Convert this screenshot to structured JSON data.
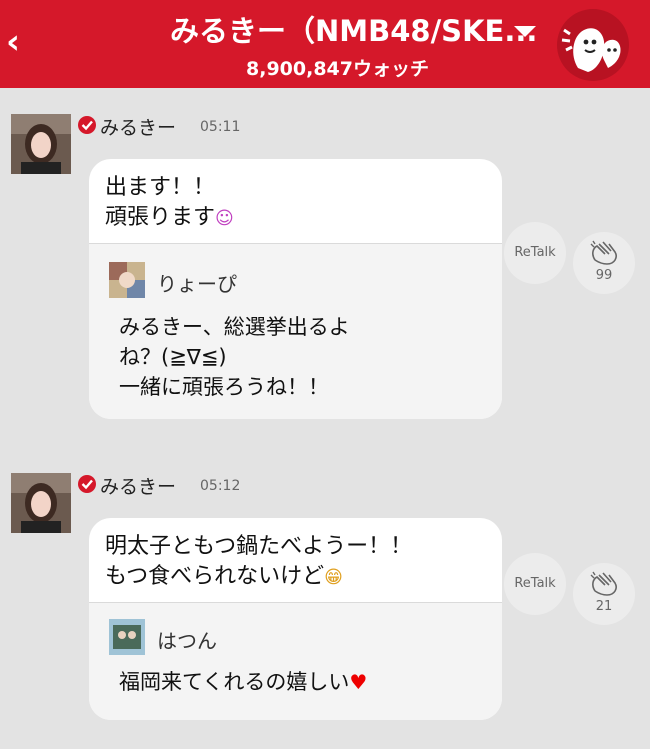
{
  "header": {
    "title": "みるきー（NMB48/SKE...",
    "watch_count": "8,900,847ウォッチ",
    "back_icon": "chevron-left-icon",
    "menu_icon": "caret-down-icon",
    "mascot_icon": "ghost-mascot-icon",
    "bg_color": "#d5182a"
  },
  "posts": [
    {
      "author": "みるきー",
      "time": "05:11",
      "message": "出ます！！\n頑張ります",
      "emoji": "☺",
      "quote": {
        "author": "りょーぴ",
        "text": "みるきー、総選挙出るよ\nね？(≧∇≦)\n一緒に頑張ろうね！！"
      },
      "retalk_label": "ReTalk",
      "clap_count": "99"
    },
    {
      "author": "みるきー",
      "time": "05:12",
      "message": "明太子ともつ鍋たべようー！！\nもつ食べられないけど",
      "emoji": "😁",
      "quote": {
        "author": "はつん",
        "text": "福岡来てくれるの嬉しい",
        "suffix": "♥"
      },
      "retalk_label": "ReTalk",
      "clap_count": "21"
    }
  ]
}
